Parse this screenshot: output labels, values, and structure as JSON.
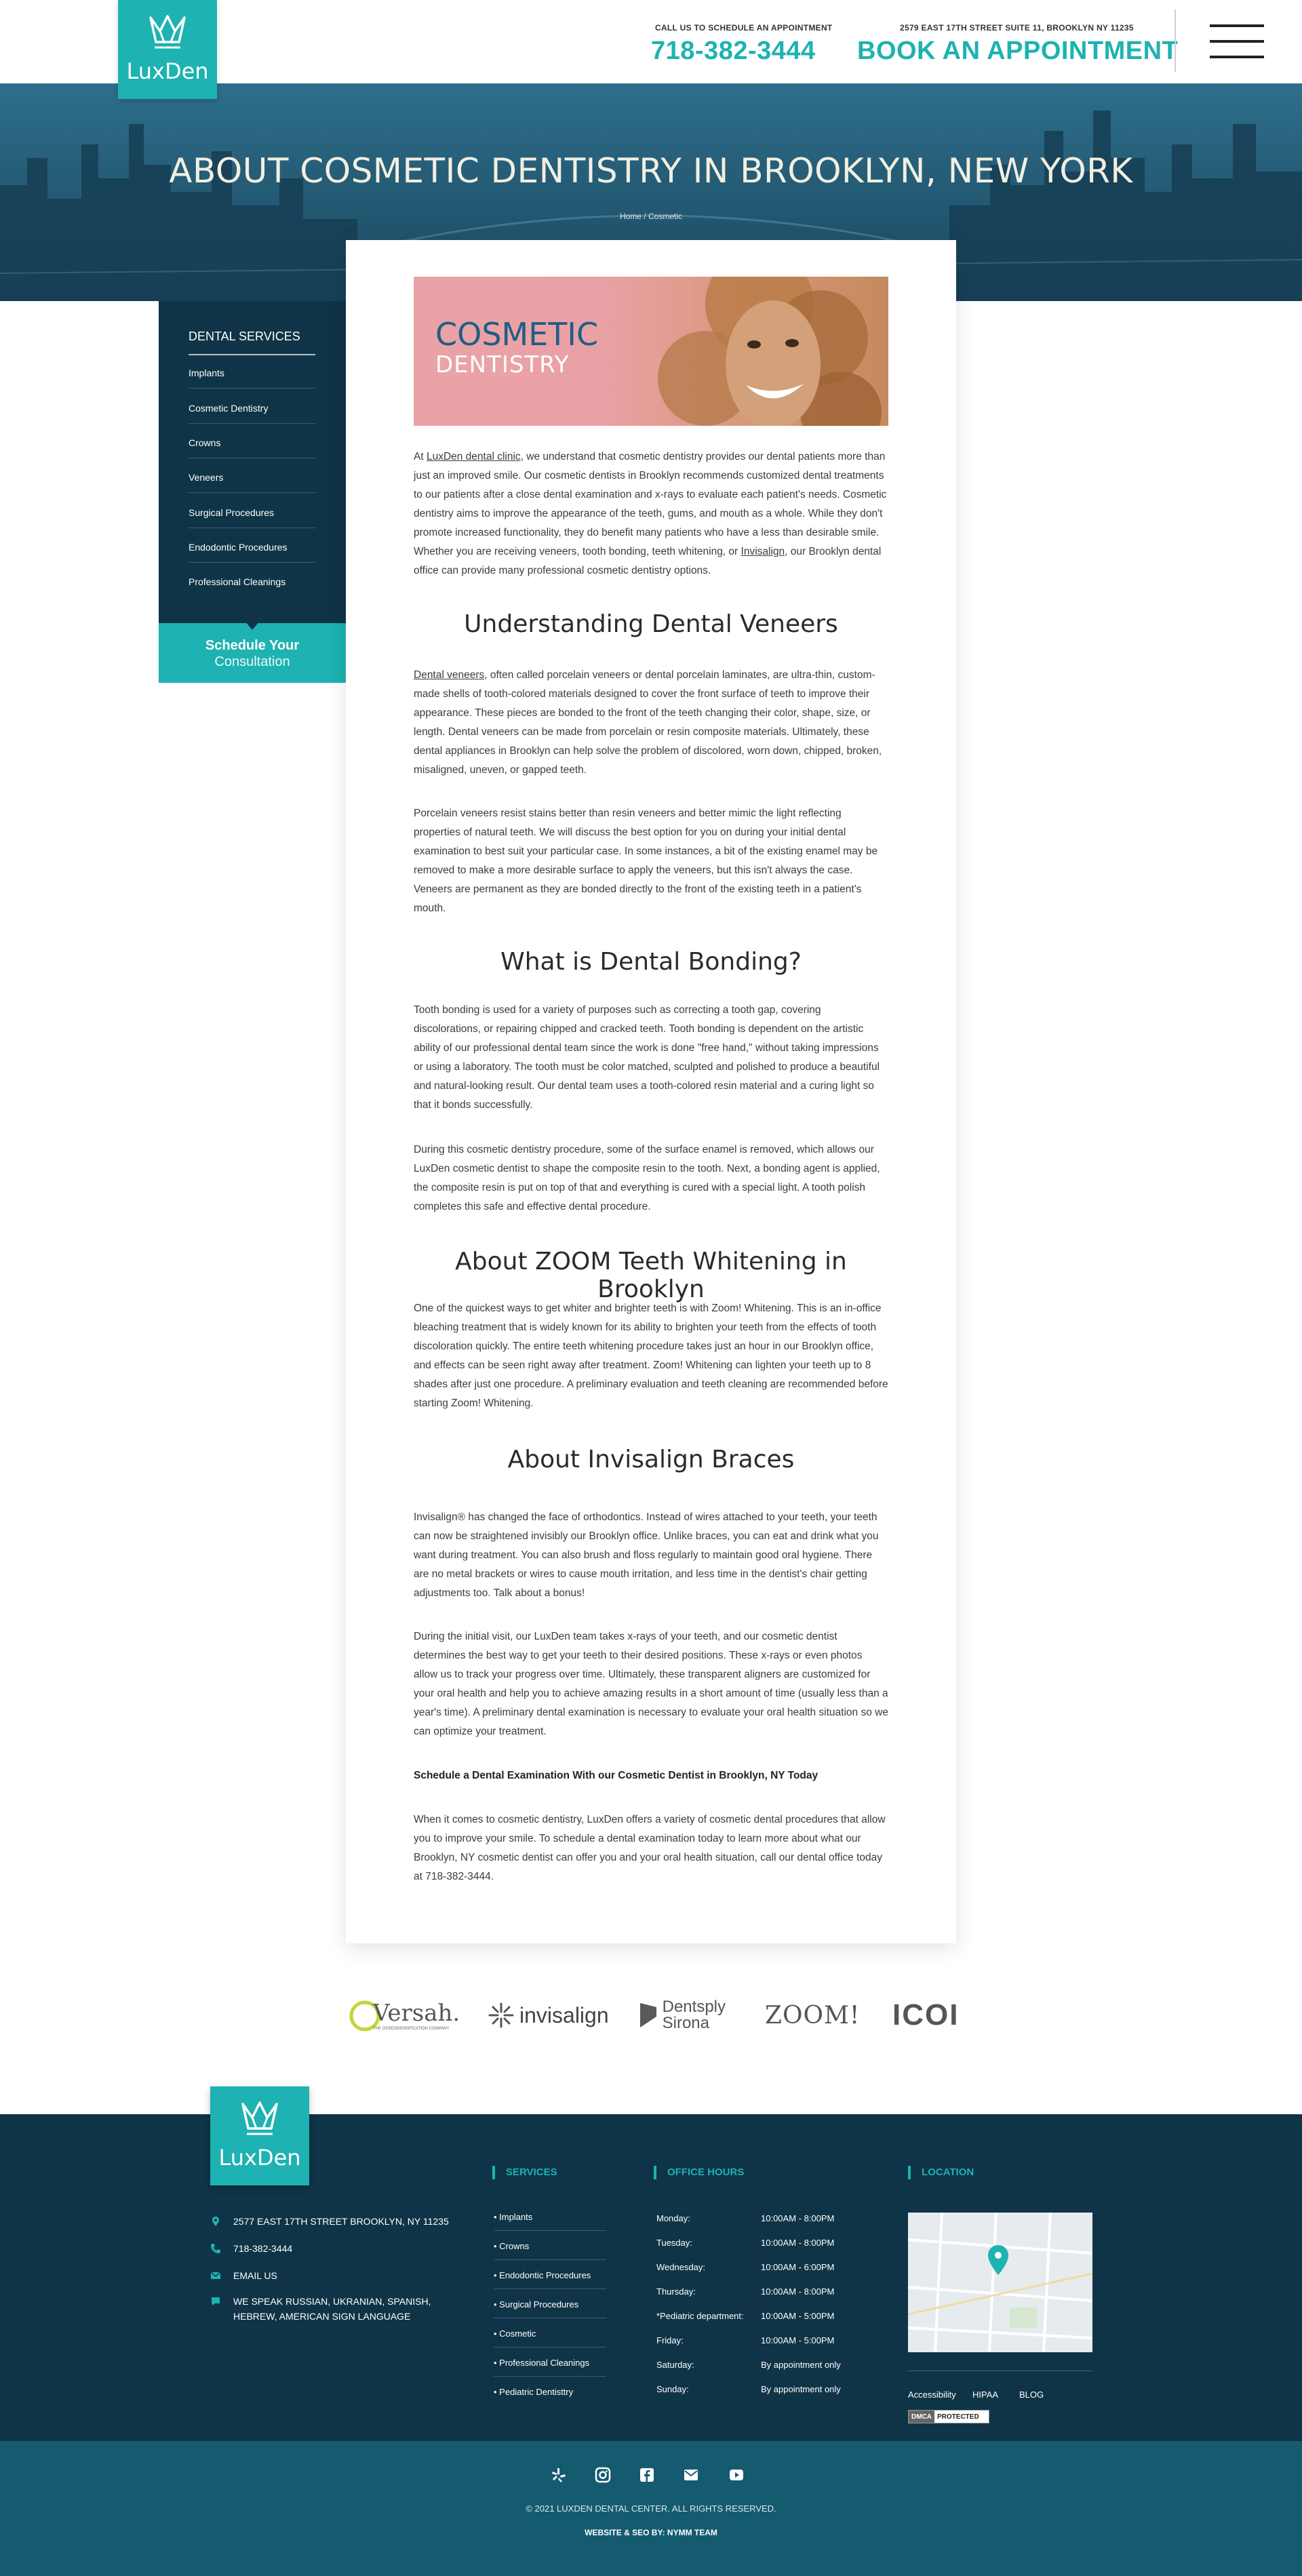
{
  "header": {
    "logo_text": "LuxDen",
    "call_label": "CALL US TO SCHEDULE AN APPOINTMENT",
    "phone": "718-382-3444",
    "address_label": "2579 EAST 17TH STREET SUITE 11, BROOKLYN NY 11235",
    "book_label": "BOOK AN APPOINTMENT",
    "menu_icon": "hamburger-icon"
  },
  "hero": {
    "title": "ABOUT COSMETIC DENTISTRY IN BROOKLYN, NEW YORK",
    "breadcrumb_home": "Home",
    "breadcrumb_sep": " / ",
    "breadcrumb_current": "Cosmetic"
  },
  "sidebar": {
    "title": "DENTAL SERVICES",
    "items": [
      {
        "label": "Implants"
      },
      {
        "label": "Cosmetic Dentistry"
      },
      {
        "label": "Crowns"
      },
      {
        "label": "Veneers"
      },
      {
        "label": "Surgical Procedures"
      },
      {
        "label": "Endodontic Procedures"
      },
      {
        "label": "Professional Cleanings"
      }
    ],
    "cta_line1": "Schedule Your",
    "cta_line2": "Consultation"
  },
  "banner": {
    "line1": "COSMETIC",
    "line2": "DENTISTRY"
  },
  "content": {
    "intro_pre": "At ",
    "intro_link": "LuxDen dental clinic",
    "intro_mid": ", we understand that cosmetic dentistry provides our dental patients more than just an improved smile. Our cosmetic dentists in Brooklyn recommends customized dental treatments to our patients after a close dental examination and x-rays to evaluate each patient's needs. Cosmetic dentistry aims to improve the appearance of the teeth, gums, and mouth as a whole. While they don't promote increased functionality, they do benefit many patients who have a less than desirable smile. Whether you are receiving veneers, tooth bonding, teeth whitening, or ",
    "intro_link2": "Invisalign",
    "intro_post": ", our Brooklyn dental office can provide many professional cosmetic dentistry options.",
    "h_veneers": "Understanding Dental Veneers",
    "veneers_link": "Dental veneers",
    "veneers_p1": ", often called porcelain veneers or dental porcelain laminates, are ultra-thin, custom-made shells of tooth-colored materials designed to cover the front surface of teeth to improve their appearance. These pieces are bonded to the front of the teeth changing their color, shape, size, or length. Dental veneers can be made from porcelain or resin composite materials. Ultimately, these dental appliances in Brooklyn can help solve the problem of discolored, worn down, chipped, broken, misaligned, uneven, or gapped teeth.",
    "veneers_p2": "Porcelain veneers resist stains better than resin veneers and better mimic the light reflecting properties of natural teeth. We will discuss the best option for you on during your initial dental examination to best suit your particular case. In some instances, a bit of the existing enamel may be removed to make a more desirable surface to apply the veneers, but this isn't always the case. Veneers are permanent as they are bonded directly to the front of the existing teeth in a patient's mouth.",
    "h_bonding": "What is Dental Bonding?",
    "bonding_p1": "Tooth bonding is used for a variety of purposes such as correcting a tooth gap, covering discolorations, or repairing chipped and cracked teeth. Tooth bonding is dependent on the artistic ability of our professional dental team since the work is done \"free hand,\" without taking impressions or using a laboratory. The tooth must be color matched, sculpted and polished to produce a beautiful and natural-looking result. Our dental team uses a tooth-colored resin material and a curing light so that it bonds successfully.",
    "bonding_p2": "During this cosmetic dentistry procedure, some of the surface enamel is removed, which allows our LuxDen cosmetic dentist to shape the composite resin to the tooth. Next, a bonding agent is applied, the composite resin is put on top of that and everything is cured with a special light. A tooth polish completes this safe and effective dental procedure.",
    "h_zoom": "About ZOOM Teeth Whitening in Brooklyn",
    "zoom_p1": "One of the quickest ways to get whiter and brighter teeth is with Zoom! Whitening. This is an in-office bleaching treatment that is widely known for its ability to brighten your teeth from the effects of tooth discoloration quickly. The entire teeth whitening procedure takes just an hour in our Brooklyn office, and effects can be seen right away after treatment. Zoom! Whitening can lighten your teeth up to 8 shades after just one procedure. A preliminary evaluation and teeth cleaning are recommended before starting Zoom! Whitening.",
    "h_invisalign": "About Invisalign Braces",
    "invisalign_p1": "Invisalign® has changed the face of orthodontics. Instead of wires attached to your teeth, your teeth can now be straightened invisibly our Brooklyn office. Unlike braces, you can eat and drink what you want during treatment. You can also brush and floss regularly to maintain good oral hygiene. There are no metal brackets or wires to cause mouth irritation, and less time in the dentist's chair getting adjustments too. Talk about a bonus!",
    "invisalign_p2": "During the initial visit, our LuxDen team takes x-rays of your teeth, and our cosmetic dentist determines the best way to get your teeth to their desired positions. These x-rays or even photos allow us to track your progress over time. Ultimately, these transparent aligners are customized for your oral health and help you to achieve amazing results in a short amount of time (usually less than a year's time). A preliminary dental examination is necessary to evaluate your oral health situation so we can optimize your treatment.",
    "schedule_heading": "Schedule a Dental Examination With our Cosmetic Dentist in Brooklyn, NY Today",
    "closing_p": "When it comes to cosmetic dentistry, LuxDen offers a variety of cosmetic dental procedures that allow you to improve your smile. To schedule a dental examination today to learn more about what our Brooklyn, NY cosmetic dentist can offer you and your oral health situation, call our dental office today at 718-382-3444."
  },
  "partners": [
    {
      "name": "Versah.",
      "sub": "THE OSSEODENSIFICATION COMPANY"
    },
    {
      "name": "invisalign"
    },
    {
      "name": "Dentsply",
      "sub": "Sirona"
    },
    {
      "name": "ZOOM!"
    },
    {
      "name": "ICOI"
    }
  ],
  "footer": {
    "logo_text": "LuxDen",
    "address": "2577 EAST 17TH STREET BROOKLYN, NY 11235",
    "phone": "718-382-3444",
    "email_label": "EMAIL US",
    "languages": "WE SPEAK RUSSIAN, UKRANIAN, SPANISH, HEBREW, AMERICAN SIGN LANGUAGE",
    "services_title": "SERVICES",
    "services": [
      {
        "label": "• Implants"
      },
      {
        "label": "• Crowns"
      },
      {
        "label": "• Endodontic Procedures"
      },
      {
        "label": "• Surgical Procedures"
      },
      {
        "label": "• Cosmetic"
      },
      {
        "label": "• Professional Cleanings"
      },
      {
        "label": "• Pediatric Dentisttry"
      }
    ],
    "hours_title": "OFFICE HOURS",
    "hours": [
      {
        "day": "Monday:",
        "time": "10:00AM - 8:00PM"
      },
      {
        "day": "Tuesday:",
        "time": "10:00AM - 8:00PM"
      },
      {
        "day": "Wednesday:",
        "time": "10:00AM - 6:00PM"
      },
      {
        "day": "Thursday:",
        "time": "10:00AM - 8:00PM"
      },
      {
        "day": "*Pediatric department:",
        "time": "10:00AM - 5:00PM"
      },
      {
        "day": "Friday:",
        "time": "10:00AM - 5:00PM"
      },
      {
        "day": "Saturday:",
        "time": "By appointment only"
      },
      {
        "day": "Sunday:",
        "time": "By appointment only"
      }
    ],
    "location_title": "LOCATION",
    "links": [
      {
        "label": "Accessibility"
      },
      {
        "label": "HIPAA"
      },
      {
        "label": "BLOG"
      }
    ],
    "dmca_a": "DMCA",
    "dmca_b": "PROTECTED",
    "copyright": "© 2021 LUXDEN DENTAL CENTER. ALL RIGHTS RESERVED.",
    "credits": "WEBSITE & SEO BY: NYMM TEAM"
  },
  "colors": {
    "accent": "#1eb2b2",
    "navy": "#0f3447",
    "bottom_bar": "#145b70"
  }
}
